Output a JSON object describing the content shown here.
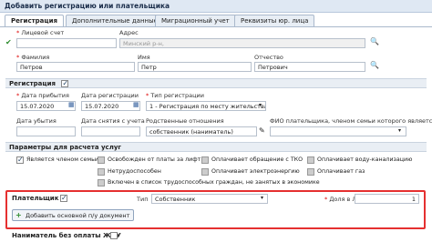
{
  "window": {
    "title": "Добавить регистрацию или плательщика"
  },
  "tabs": [
    "Регистрация",
    "Дополнительные данные",
    "Миграционный учет",
    "Реквизиты юр. лица"
  ],
  "top": {
    "account_label": "Лицевой счет",
    "account_value": "",
    "address_label": "Адрес",
    "address_value": "Минский р-н,",
    "surname_label": "Фамилия",
    "surname_value": "Петров",
    "name_label": "Имя",
    "name_value": "Петр",
    "patronymic_label": "Отчество",
    "patronymic_value": "Петрович"
  },
  "registration": {
    "title": "Регистрация",
    "arrival_label": "Дата прибытия",
    "arrival_value": "15.07.2020",
    "reg_date_label": "Дата регистрации",
    "reg_date_value": "15.07.2020",
    "reg_type_label": "Тип регистрации",
    "reg_type_value": "1 - Регистрация по месту жительства",
    "departure_label": "Дата убытия",
    "departure_value": "",
    "dereg_label": "Дата снятия с учета",
    "dereg_value": "",
    "relation_label": "Родственные отношения",
    "relation_value": "собственник (наниматель)",
    "payer_fio_label": "ФИО плательщика, членом семьи которого является",
    "payer_fio_value": ""
  },
  "params": {
    "title": "Параметры для расчета услуг",
    "family_member": "Является членом семьи",
    "opts": [
      "Освобожден от платы за лифт",
      "Оплачивает обращение с ТКО",
      "Оплачивает воду-канализацию",
      "Нетрудоспособен",
      "Оплачивает электроэнергию",
      "Оплачивает газ",
      "Включен в список трудоспособных граждан, не занятых в экономике"
    ]
  },
  "payer": {
    "title": "Плательщик",
    "type_label": "Тип",
    "type_value": "Собственник",
    "share_label": "Доля в ЛС",
    "share_value": "1",
    "add_doc_button": "Добавить основной п/у документ"
  },
  "tenant": {
    "title": "Наниматель без оплаты ЖКУ"
  }
}
